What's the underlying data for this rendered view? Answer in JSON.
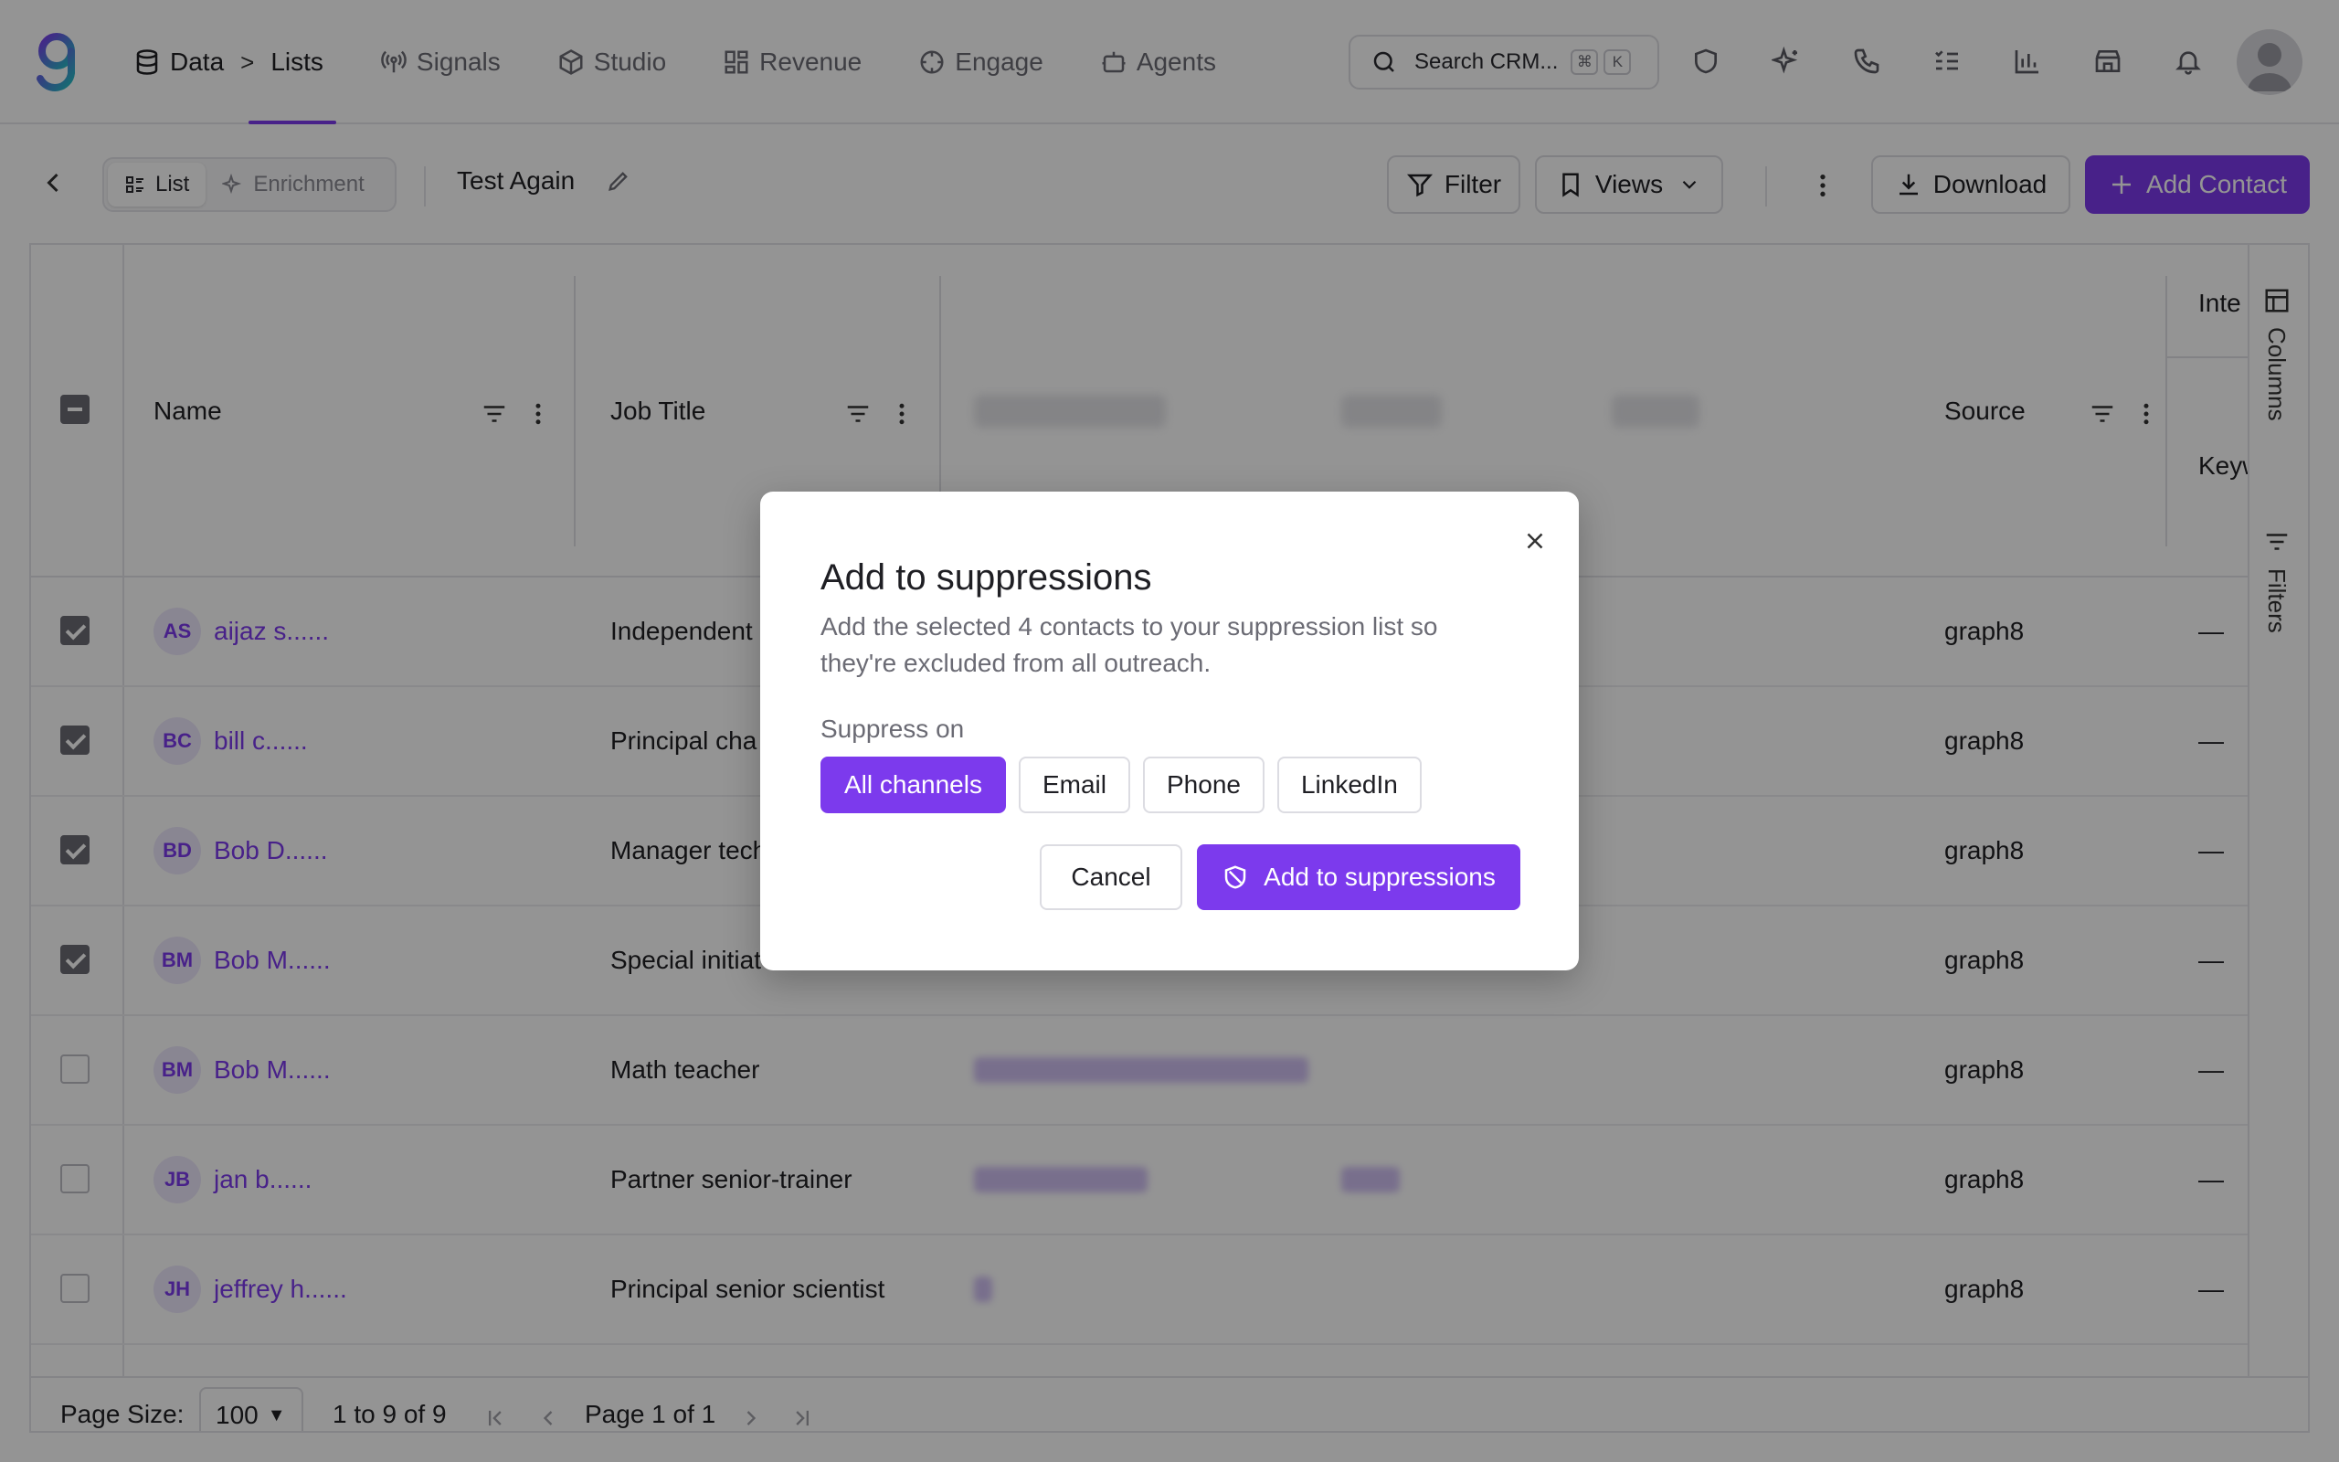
{
  "nav": {
    "crumbs": [
      "Data",
      "Lists"
    ],
    "items": [
      {
        "label": "Signals",
        "icon": "signal-icon"
      },
      {
        "label": "Studio",
        "icon": "cube-icon"
      },
      {
        "label": "Revenue",
        "icon": "grid-icon"
      },
      {
        "label": "Engage",
        "icon": "target-icon"
      },
      {
        "label": "Agents",
        "icon": "robot-icon"
      }
    ],
    "search_placeholder": "Search CRM...",
    "search_keys": [
      "⌘",
      "K"
    ]
  },
  "toolbar": {
    "list_tab": "List",
    "enrichment_tab": "Enrichment",
    "list_name": "Test Again",
    "filter": "Filter",
    "views": "Views",
    "download": "Download",
    "add_contact": "Add Contact"
  },
  "table": {
    "headers": {
      "name": "Name",
      "job_title": "Job Title",
      "source": "Source",
      "inte": "Inte",
      "keyw": "Keyw"
    },
    "rows": [
      {
        "initials": "AS",
        "name": "aijaz s......",
        "job_title": "Independent",
        "source": "graph8",
        "extra": "—",
        "checked": true
      },
      {
        "initials": "BC",
        "name": "bill c......",
        "job_title": "Principal cha",
        "source": "graph8",
        "extra": "—",
        "checked": true
      },
      {
        "initials": "BD",
        "name": "Bob D......",
        "job_title": "Manager tech",
        "source": "graph8",
        "extra": "—",
        "checked": true
      },
      {
        "initials": "BM",
        "name": "Bob M......",
        "job_title": "Special initiat",
        "source": "graph8",
        "extra": "—",
        "checked": true
      },
      {
        "initials": "BM",
        "name": "Bob M......",
        "job_title": "Math teacher",
        "source": "graph8",
        "extra": "—",
        "checked": false
      },
      {
        "initials": "JB",
        "name": "jan b......",
        "job_title": "Partner senior-trainer",
        "source": "graph8",
        "extra": "—",
        "checked": false
      },
      {
        "initials": "JH",
        "name": "jeffrey h......",
        "job_title": "Principal senior scientist",
        "source": "graph8",
        "extra": "—",
        "checked": false
      }
    ],
    "side_columns": "Columns",
    "side_filters": "Filters"
  },
  "footer": {
    "page_size_label": "Page Size:",
    "page_size_value": "100",
    "range_text": "1 to 9 of 9",
    "page_text": "Page 1 of 1"
  },
  "modal": {
    "title": "Add to suppressions",
    "description": "Add the selected 4 contacts to your suppression list so they're excluded from all outreach.",
    "suppress_label": "Suppress on",
    "channels": [
      "All channels",
      "Email",
      "Phone",
      "LinkedIn"
    ],
    "selected_channel": "All channels",
    "cancel": "Cancel",
    "confirm": "Add to suppressions"
  },
  "colors": {
    "accent": "#7c3aed"
  }
}
